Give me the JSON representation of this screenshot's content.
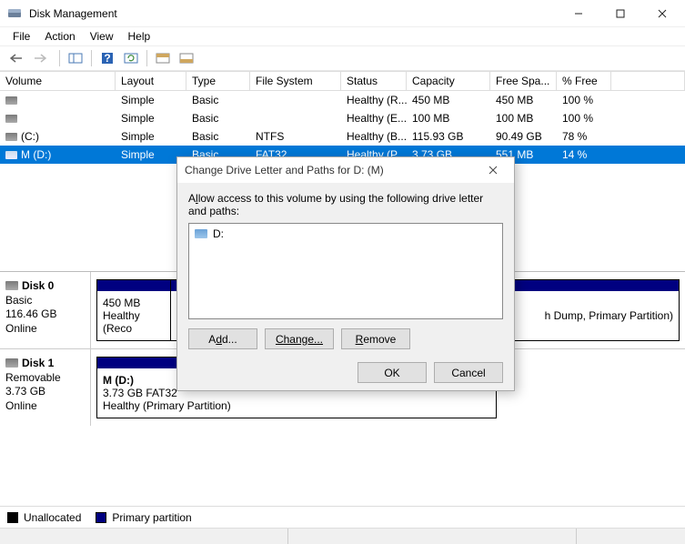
{
  "window": {
    "title": "Disk Management"
  },
  "menu": {
    "file": "File",
    "action": "Action",
    "view": "View",
    "help": "Help"
  },
  "columns": {
    "c0": "Volume",
    "c1": "Layout",
    "c2": "Type",
    "c3": "File System",
    "c4": "Status",
    "c5": "Capacity",
    "c6": "Free Spa...",
    "c7": "% Free"
  },
  "volumes": [
    {
      "name": "",
      "layout": "Simple",
      "type": "Basic",
      "fs": "",
      "status": "Healthy (R...",
      "cap": "450 MB",
      "free": "450 MB",
      "pct": "100 %"
    },
    {
      "name": "",
      "layout": "Simple",
      "type": "Basic",
      "fs": "",
      "status": "Healthy (E...",
      "cap": "100 MB",
      "free": "100 MB",
      "pct": "100 %"
    },
    {
      "name": "(C:)",
      "layout": "Simple",
      "type": "Basic",
      "fs": "NTFS",
      "status": "Healthy (B...",
      "cap": "115.93 GB",
      "free": "90.49 GB",
      "pct": "78 %"
    },
    {
      "name": "M (D:)",
      "layout": "Simple",
      "type": "Basic",
      "fs": "FAT32",
      "status": "Healthy (P...",
      "cap": "3.73 GB",
      "free": "551 MB",
      "pct": "14 %"
    }
  ],
  "disk0": {
    "title": "Disk 0",
    "type": "Basic",
    "size": "116.46 GB",
    "state": "Online",
    "p0_size": "450 MB",
    "p0_status": "Healthy (Reco",
    "p_right_tail": "h Dump, Primary Partition)"
  },
  "disk1": {
    "title": "Disk 1",
    "type": "Removable",
    "size": "3.73 GB",
    "state": "Online",
    "p0_name": "M  (D:)",
    "p0_size": "3.73 GB FAT32",
    "p0_status": "Healthy (Primary Partition)"
  },
  "legend": {
    "unalloc": "Unallocated",
    "primary": "Primary partition"
  },
  "dialog": {
    "title": "Change Drive Letter and Paths for D: (M)",
    "instr_pre": "A",
    "instr_u": "l",
    "instr_post": "low access to this volume by using the following drive letter and paths:",
    "list_item": "D:",
    "btn_add_pre": "A",
    "btn_add_u": "d",
    "btn_add_post": "d...",
    "btn_change": "Change...",
    "btn_remove_u": "R",
    "btn_remove_post": "emove",
    "btn_ok": "OK",
    "btn_cancel": "Cancel"
  }
}
